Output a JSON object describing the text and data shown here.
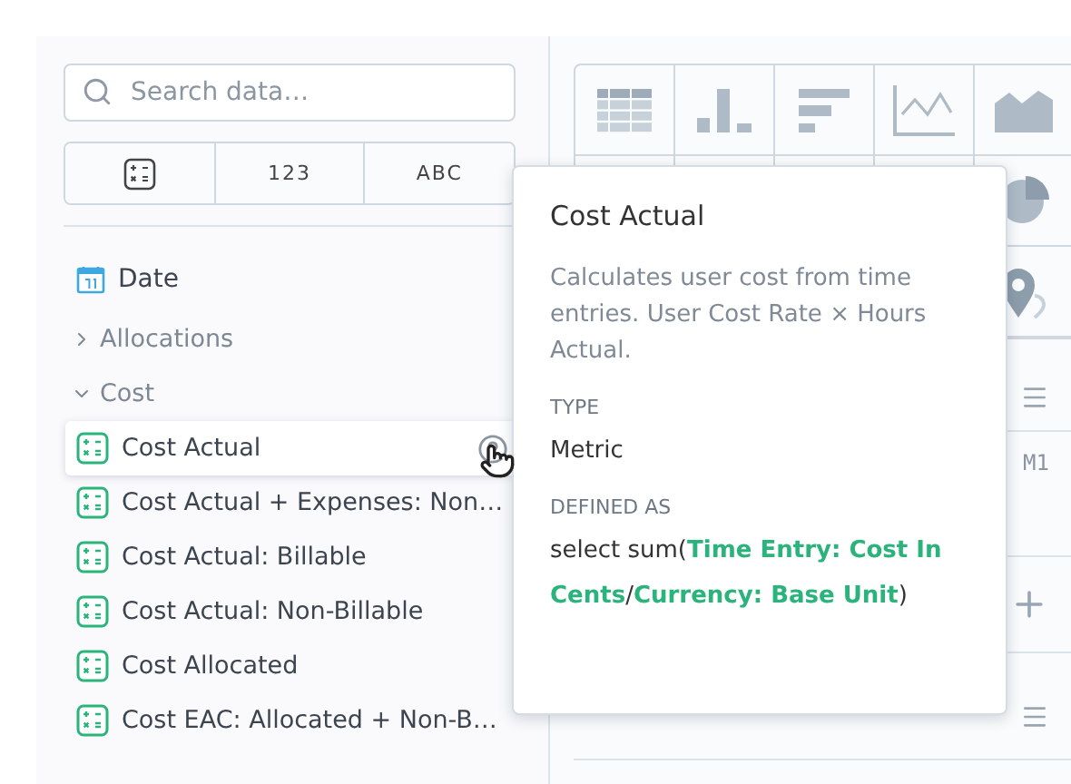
{
  "search": {
    "placeholder": "Search data…"
  },
  "filters": [
    {
      "kind": "icon"
    },
    {
      "kind": "text",
      "label": "123"
    },
    {
      "kind": "text",
      "label": "ABC"
    }
  ],
  "tree": [
    {
      "kind": "date",
      "label": "Date"
    },
    {
      "kind": "folder",
      "label": "Allocations",
      "expanded": false
    },
    {
      "kind": "folder",
      "label": "Cost",
      "expanded": true,
      "children": [
        {
          "label": "Cost Actual",
          "hovered": true
        },
        {
          "label": "Cost Actual + Expenses: Non…",
          "hovered": false
        },
        {
          "label": "Cost Actual: Billable",
          "hovered": false
        },
        {
          "label": "Cost Actual: Non-Billable",
          "hovered": false
        },
        {
          "label": "Cost Allocated",
          "hovered": false
        },
        {
          "label": "Cost EAC: Allocated + Non-B…",
          "hovered": false
        }
      ]
    }
  ],
  "bucket_marker": "M1",
  "tooltip": {
    "title": "Cost Actual",
    "description": "Calculates user cost from time entries. User Cost Rate × Hours Actual.",
    "sections": [
      {
        "heading": "TYPE",
        "value": "Metric"
      },
      {
        "heading": "DEFINED AS",
        "value": "select sum(**Time Entry: Cost In Cents**/**Currency: Base Unit**)"
      }
    ]
  }
}
